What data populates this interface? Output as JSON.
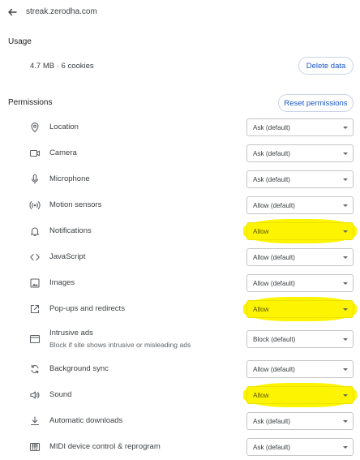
{
  "header": {
    "site_url": "streak.zerodha.com",
    "back_icon": "arrow-left-icon"
  },
  "usage": {
    "title": "Usage",
    "summary": "4.7 MB · 6 cookies",
    "delete_label": "Delete data"
  },
  "permissions": {
    "title": "Permissions",
    "reset_label": "Reset permissions",
    "items": [
      {
        "label": "Location",
        "icon": "location-pin-icon",
        "value": "Ask (default)",
        "highlighted": false
      },
      {
        "label": "Camera",
        "icon": "camera-icon",
        "value": "Ask (default)",
        "highlighted": false
      },
      {
        "label": "Microphone",
        "icon": "microphone-icon",
        "value": "Ask (default)",
        "highlighted": false
      },
      {
        "label": "Motion sensors",
        "icon": "motion-sensors-icon",
        "value": "Allow (default)",
        "highlighted": false
      },
      {
        "label": "Notifications",
        "icon": "bell-icon",
        "value": "Allow",
        "highlighted": true
      },
      {
        "label": "JavaScript",
        "icon": "code-brackets-icon",
        "value": "Allow (default)",
        "highlighted": false
      },
      {
        "label": "Images",
        "icon": "image-icon",
        "value": "Allow (default)",
        "highlighted": false
      },
      {
        "label": "Pop-ups and redirects",
        "icon": "open-in-new-icon",
        "value": "Allow",
        "highlighted": true
      },
      {
        "label": "Intrusive ads",
        "sublabel": "Block if site shows intrusive or misleading ads",
        "icon": "ad-window-icon",
        "value": "Block (default)",
        "highlighted": false
      },
      {
        "label": "Background sync",
        "icon": "sync-icon",
        "value": "Allow (default)",
        "highlighted": false
      },
      {
        "label": "Sound",
        "icon": "speaker-icon",
        "value": "Allow",
        "highlighted": true
      },
      {
        "label": "Automatic downloads",
        "icon": "download-icon",
        "value": "Ask (default)",
        "highlighted": false
      },
      {
        "label": "MIDI device control & reprogram",
        "icon": "midi-piano-icon",
        "value": "Ask (default)",
        "highlighted": false
      }
    ]
  },
  "colors": {
    "accent": "#1a56c8",
    "highlight": "#fcf400",
    "text": "#3c4043"
  }
}
